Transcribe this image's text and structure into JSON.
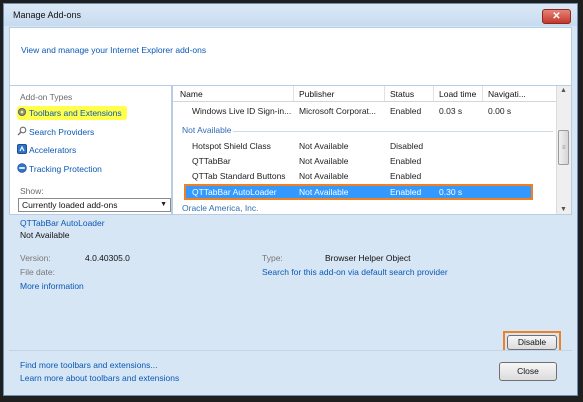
{
  "window": {
    "title": "Manage Add-ons",
    "close_glyph": "✕"
  },
  "header": {
    "link": "View and manage your Internet Explorer add-ons"
  },
  "sidebar": {
    "heading": "Add-on Types",
    "items": [
      {
        "label": "Toolbars and Extensions",
        "icon": "gear-icon"
      },
      {
        "label": "Search Providers",
        "icon": "search-icon"
      },
      {
        "label": "Accelerators",
        "icon": "accelerator-icon"
      },
      {
        "label": "Tracking Protection",
        "icon": "tracking-protection-icon"
      }
    ],
    "show_label": "Show:",
    "show_value": "Currently loaded add-ons",
    "highlight_color": "#ffff4c"
  },
  "list": {
    "columns": [
      "Name",
      "Publisher",
      "Status",
      "Load time",
      "Navigati..."
    ],
    "top_row": {
      "name": "Windows Live ID Sign-in...",
      "publisher": "Microsoft Corporat...",
      "status": "Enabled",
      "load": "0.03 s",
      "nav": "0.00 s"
    },
    "group_not_available": "Not Available",
    "rows": [
      {
        "name": "Hotspot Shield Class",
        "publisher": "Not Available",
        "status": "Disabled",
        "load": ""
      },
      {
        "name": "QTTabBar",
        "publisher": "Not Available",
        "status": "Enabled",
        "load": ""
      },
      {
        "name": "QTTab Standard Buttons",
        "publisher": "Not Available",
        "status": "Enabled",
        "load": ""
      },
      {
        "name": "QTTabBar AutoLoader",
        "publisher": "Not Available",
        "status": "Enabled",
        "load": "0.30 s"
      }
    ],
    "group_oracle": "Oracle America, Inc."
  },
  "detail": {
    "name": "QTTabBar AutoLoader",
    "publisher": "Not Available",
    "version_label": "Version:",
    "version_value": "4.0.40305.0",
    "file_date_label": "File date:",
    "more_info": "More information",
    "type_label": "Type:",
    "type_value": "Browser Helper Object",
    "search_link": "Search for this add-on via default search provider"
  },
  "buttons": {
    "disable": "Disable",
    "close": "Close"
  },
  "footer": {
    "link1": "Find more toolbars and extensions...",
    "link2": "Learn more about toolbars and extensions"
  },
  "colors": {
    "selection": "#3399ff",
    "annotation": "#f08122",
    "link": "#0a58b5"
  }
}
